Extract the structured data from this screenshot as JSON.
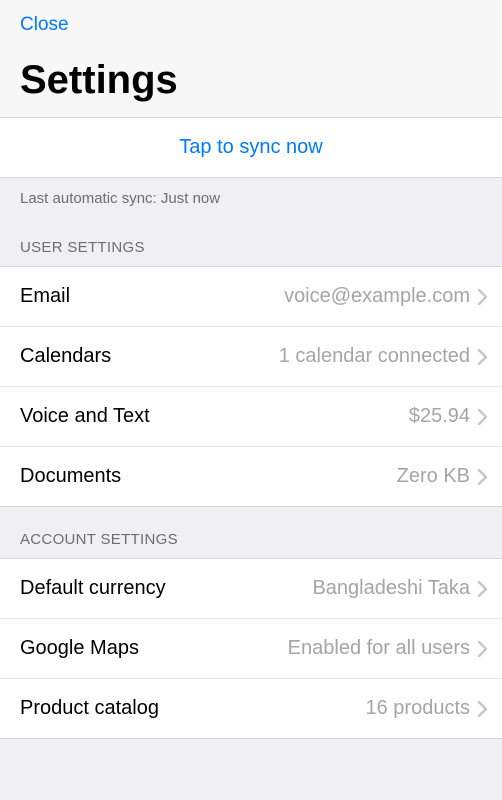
{
  "header": {
    "close_label": "Close",
    "title": "Settings"
  },
  "sync": {
    "button_label": "Tap to sync now",
    "status": "Last automatic sync: Just now"
  },
  "sections": {
    "user": {
      "header": "USER SETTINGS",
      "rows": {
        "email": {
          "label": "Email",
          "value": "voice@example.com"
        },
        "calendars": {
          "label": "Calendars",
          "value": "1 calendar connected"
        },
        "voice_text": {
          "label": "Voice and Text",
          "value": "$25.94"
        },
        "documents": {
          "label": "Documents",
          "value": "Zero KB"
        }
      }
    },
    "account": {
      "header": "ACCOUNT SETTINGS",
      "rows": {
        "currency": {
          "label": "Default currency",
          "value": "Bangladeshi Taka"
        },
        "maps": {
          "label": "Google Maps",
          "value": "Enabled for all users"
        },
        "catalog": {
          "label": "Product catalog",
          "value": "16 products"
        }
      }
    }
  }
}
